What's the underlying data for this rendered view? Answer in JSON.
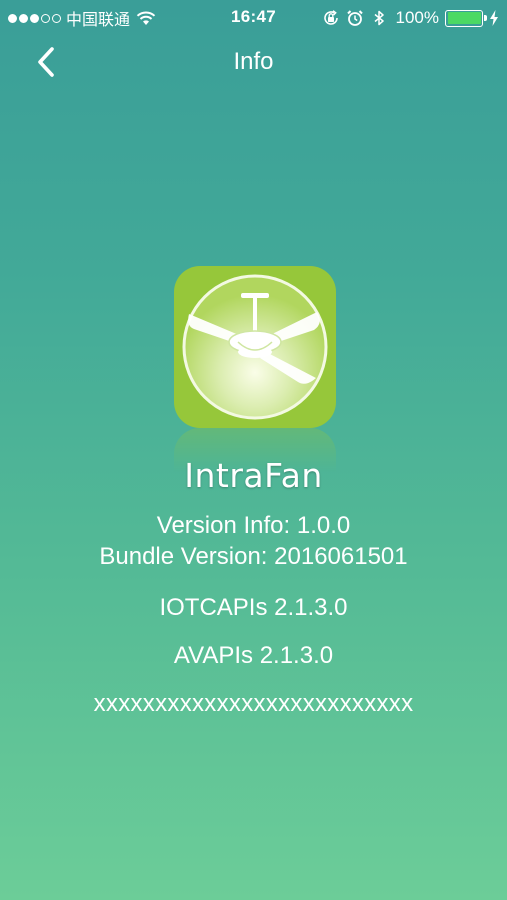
{
  "status_bar": {
    "carrier": "中国联通",
    "time": "16:47",
    "battery_percent": "100%",
    "battery_level": 1.0,
    "signal_bars": 3,
    "signal_total": 5
  },
  "nav": {
    "title": "Info"
  },
  "app": {
    "name": "IntraFan",
    "icon": "ceiling-fan-icon"
  },
  "info": {
    "version": "Version Info: 1.0.0",
    "bundle_version": "Bundle Version: 2016061501",
    "iotc_apis": "IOTCAPIs 2.1.3.0",
    "av_apis": "AVAPIs 2.1.3.0",
    "serial": "xxxxxxxxxxxxxxxxxxxxxxxxxx"
  },
  "colors": {
    "background_top": "#3a9e98",
    "background_bottom": "#6ccd98",
    "icon_green": "#96c73a",
    "battery_green": "#4cd964"
  }
}
